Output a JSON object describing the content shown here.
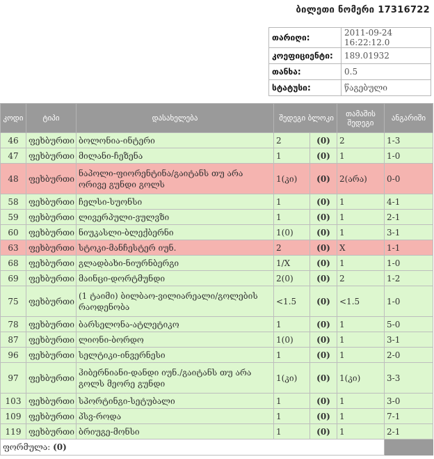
{
  "ticket": {
    "title_prefix": "ბილეთი ნომერი",
    "number": "17316722"
  },
  "info": [
    {
      "label": "თარიღი:",
      "value": "2011-09-24 16:22:12.0"
    },
    {
      "label": "კოეფიციენტი:",
      "value": "189.01932"
    },
    {
      "label": "თანხა:",
      "value": "0.5"
    },
    {
      "label": "სტატუსი:",
      "value": "წაგებული"
    }
  ],
  "table": {
    "headers": [
      "კოდი",
      "ტიპი",
      "დასახელება",
      "შედეგი ბლოკი",
      "",
      "თამაშის შედეგი",
      "ანგარიში"
    ],
    "rows": [
      {
        "code": "46",
        "type": "ფეხბურთი",
        "name": "ბოლონია-ინტერი",
        "bet": "2",
        "block": "(0)",
        "result": "2",
        "score": "1-3",
        "status": "win"
      },
      {
        "code": "47",
        "type": "ფეხბურთი",
        "name": "მილანი-ჩეზენა",
        "bet": "1",
        "block": "(0)",
        "result": "1",
        "score": "1-0",
        "status": "win"
      },
      {
        "code": "48",
        "type": "ფეხბურთი",
        "name": "ნაპოლი-ფიორენტინა/გაიტანს თუ არა ორივე გუნდი გოლს",
        "bet": "1(კი)",
        "block": "(0)",
        "result": "2(არა)",
        "score": "0-0",
        "status": "lose"
      },
      {
        "code": "58",
        "type": "ფეხბურთი",
        "name": "ჩელსი-სუონსი",
        "bet": "1",
        "block": "(0)",
        "result": "1",
        "score": "4-1",
        "status": "win"
      },
      {
        "code": "59",
        "type": "ფეხბურთი",
        "name": "ლივერპული-ვულვზი",
        "bet": "1",
        "block": "(0)",
        "result": "1",
        "score": "2-1",
        "status": "win"
      },
      {
        "code": "60",
        "type": "ფეხბურთი",
        "name": "ნიუკასლი-ბლექბერნი",
        "bet": "1(0)",
        "block": "(0)",
        "result": "1",
        "score": "3-1",
        "status": "win"
      },
      {
        "code": "63",
        "type": "ფეხბურთი",
        "name": "სტოკი-მანჩესტერ იუნ.",
        "bet": "2",
        "block": "(0)",
        "result": "X",
        "score": "1-1",
        "status": "lose"
      },
      {
        "code": "68",
        "type": "ფეხბურთი",
        "name": "გლადბახი-ნიურნბერგი",
        "bet": "1/X",
        "block": "(0)",
        "result": "1",
        "score": "1-0",
        "status": "win"
      },
      {
        "code": "69",
        "type": "ფეხბურთი",
        "name": "მაინცი-დორტმუნდი",
        "bet": "2(0)",
        "block": "(0)",
        "result": "2",
        "score": "1-2",
        "status": "win"
      },
      {
        "code": "75",
        "type": "ფეხბურთი",
        "name": "(1 ტაიმი) ბილბაო-ვილიარეალი/გოლების რაოდენობა",
        "bet": "<1.5",
        "block": "(0)",
        "result": "<1.5",
        "score": "1-0",
        "status": "win"
      },
      {
        "code": "78",
        "type": "ფეხბურთი",
        "name": "ბარსელონა-ატლეტიკო",
        "bet": "1",
        "block": "(0)",
        "result": "1",
        "score": "5-0",
        "status": "win"
      },
      {
        "code": "87",
        "type": "ფეხბურთი",
        "name": "ლიონი-ბორდო",
        "bet": "1(0)",
        "block": "(0)",
        "result": "1",
        "score": "3-1",
        "status": "win"
      },
      {
        "code": "96",
        "type": "ფეხბურთი",
        "name": "სელტიკი-ინვერნესი",
        "bet": "1",
        "block": "(0)",
        "result": "1",
        "score": "2-0",
        "status": "win"
      },
      {
        "code": "97",
        "type": "ფეხბურთი",
        "name": "ჰიბერნიანი-დანდი იუნ./გაიტანს თუ არა გოლს მეორე გუნდი",
        "bet": "1(კი)",
        "block": "(0)",
        "result": "1(კი)",
        "score": "3-3",
        "status": "win"
      },
      {
        "code": "103",
        "type": "ფეხბურთი",
        "name": "სპორტინგი-სეტუბალი",
        "bet": "1",
        "block": "(0)",
        "result": "1",
        "score": "3-0",
        "status": "win"
      },
      {
        "code": "109",
        "type": "ფეხბურთი",
        "name": "პსვ-როდა",
        "bet": "1",
        "block": "(0)",
        "result": "1",
        "score": "7-1",
        "status": "win"
      },
      {
        "code": "119",
        "type": "ფეხბურთი",
        "name": "ბრიუგე-მონსი",
        "bet": "1",
        "block": "(0)",
        "result": "1",
        "score": "2-1",
        "status": "win"
      }
    ]
  },
  "footer": {
    "formula_label": "ფორმულა:",
    "formula_value": "(0)"
  },
  "colors": {
    "header_bg": "#9a9a9a",
    "win_row": "#ddf7cf",
    "lose_row": "#f5b4b0"
  }
}
